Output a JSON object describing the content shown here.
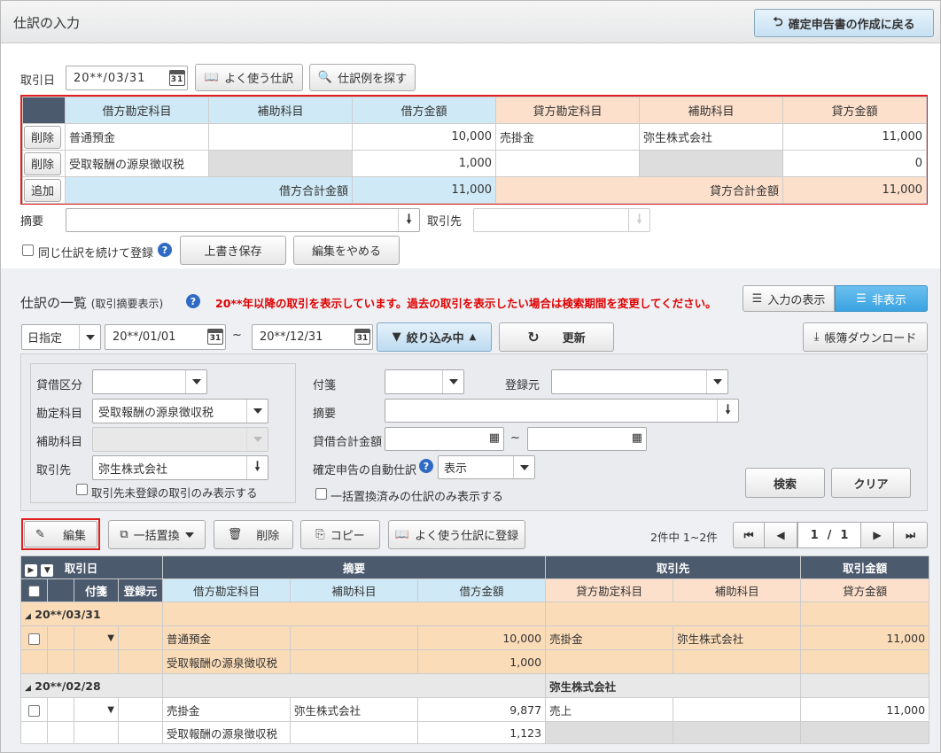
{
  "header": {
    "title": "仕訳の入力",
    "back_button": "確定申告書の作成に戻る"
  },
  "entry": {
    "date_label": "取引日",
    "date_value": "20**/03/31",
    "frequent_button": "よく使う仕訳",
    "search_example_button": "仕訳例を探す",
    "columns": [
      "借方勘定科目",
      "補助科目",
      "借方金額",
      "貸方勘定科目",
      "補助科目",
      "貸方金額"
    ],
    "rows": [
      {
        "action": "削除",
        "debit_account": "普通預金",
        "debit_sub": "",
        "debit_amount": "10,000",
        "credit_account": "売掛金",
        "credit_sub": "弥生株式会社",
        "credit_amount": "11,000"
      },
      {
        "action": "削除",
        "debit_account": "受取報酬の源泉徴収税",
        "debit_sub": "",
        "debit_amount": "1,000",
        "credit_account": "",
        "credit_sub": "",
        "credit_amount": "0"
      }
    ],
    "add_button": "追加",
    "debit_total_label": "借方合計金額",
    "debit_total": "11,000",
    "credit_total_label": "貸方合計金額",
    "credit_total": "11,000",
    "memo_label": "摘要",
    "partner_label": "取引先",
    "continue_label": "同じ仕訳を続けて登録",
    "overwrite_button": "上書き保存",
    "cancel_button": "編集をやめる"
  },
  "list": {
    "title": "仕訳の一覧",
    "title_sub": "(取引摘要表示)",
    "notice": "20**年以降の取引を表示しています。過去の取引を表示したい場合は検索期間を変更してください。",
    "toggle_show": "入力の表示",
    "toggle_hide": "非表示",
    "period_select": "日指定",
    "date_from": "20**/01/01",
    "date_to": "20**/12/31",
    "tilde": "~",
    "filter_button": "絞り込み中",
    "refresh_button": "更新",
    "download_button": "帳簿ダウンロード"
  },
  "filter": {
    "dc_label": "貸借区分",
    "dc_value": "",
    "account_label": "勘定科目",
    "account_value": "受取報酬の源泉徴収税",
    "sub_label": "補助科目",
    "partner_label": "取引先",
    "partner_value": "弥生株式会社",
    "unregistered_label": "取引先未登録の取引のみ表示する",
    "tag_label": "付箋",
    "source_label": "登録元",
    "memo_label": "摘要",
    "total_label": "貸借合計金額",
    "auto_label": "確定申告の自動仕訳",
    "auto_value": "表示",
    "bulk_only_label": "一括置換済みの仕訳のみ表示する",
    "search_button": "検索",
    "clear_button": "クリア"
  },
  "toolbar": {
    "edit": "編集",
    "bulk_replace": "一括置換",
    "delete": "削除",
    "copy": "コピー",
    "register_frequent": "よく使う仕訳に登録",
    "count": "2件中 1~2件",
    "page_current": "1",
    "page_sep": "/",
    "page_total": "1"
  },
  "table": {
    "h_date": "取引日",
    "h_memo": "摘要",
    "h_partner": "取引先",
    "h_amount": "取引金額",
    "h_tag": "付箋",
    "h_source": "登録元",
    "h_debit_account": "借方勘定科目",
    "h_debit_sub": "補助科目",
    "h_debit_amount": "借方金額",
    "h_credit_account": "貸方勘定科目",
    "h_credit_sub": "補助科目",
    "h_credit_amount": "貸方金額",
    "groups": [
      {
        "date": "20**/03/31",
        "partner": "",
        "lines": [
          {
            "debit_account": "普通預金",
            "debit_sub": "",
            "debit_amount": "10,000",
            "credit_account": "売掛金",
            "credit_sub": "弥生株式会社",
            "credit_amount": "11,000"
          },
          {
            "debit_account": "受取報酬の源泉徴収税",
            "debit_sub": "",
            "debit_amount": "1,000",
            "credit_account": "",
            "credit_sub": "",
            "credit_amount": ""
          }
        ]
      },
      {
        "date": "20**/02/28",
        "partner": "弥生株式会社",
        "lines": [
          {
            "debit_account": "売掛金",
            "debit_sub": "弥生株式会社",
            "debit_amount": "9,877",
            "credit_account": "売上",
            "credit_sub": "",
            "credit_amount": "11,000"
          },
          {
            "debit_account": "受取報酬の源泉徴収税",
            "debit_sub": "",
            "debit_amount": "1,123",
            "credit_account": "",
            "credit_sub": "",
            "credit_amount": ""
          }
        ]
      }
    ]
  },
  "colors": {
    "accent": "#e02020",
    "debit_bg": "#cfeaf6",
    "credit_bg": "#fde0cb",
    "header_dark": "#4c5a6e",
    "notice": "#e00000"
  }
}
